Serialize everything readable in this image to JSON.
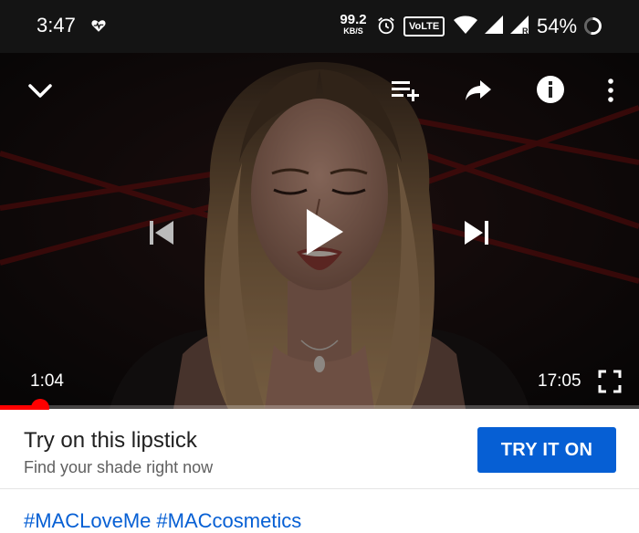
{
  "status_bar": {
    "time": "3:47",
    "net_speed_value": "99.2",
    "net_speed_unit": "KB/S",
    "volte_label": "VoLTE",
    "battery_percent": "54%",
    "icons": [
      "heart-pulse-icon",
      "alarm-icon",
      "volte-icon",
      "wifi-icon",
      "signal-icon",
      "signal-roaming-icon",
      "battery-ring-icon"
    ]
  },
  "player": {
    "current_time": "1:04",
    "duration": "17:05",
    "progress_fraction": 0.0625,
    "accent_color": "#ff0000",
    "icons": [
      "chevron-down-icon",
      "add-to-queue-icon",
      "share-icon",
      "info-icon",
      "more-vert-icon",
      "skip-previous-icon",
      "play-icon",
      "skip-next-icon",
      "fullscreen-icon"
    ]
  },
  "ad": {
    "title": "Try on this lipstick",
    "subtitle": "Find your shade right now",
    "cta_label": "TRY IT ON",
    "cta_color": "#065fd4"
  },
  "hashtags": [
    "#MACLoveMe",
    "#MACcosmetics"
  ]
}
